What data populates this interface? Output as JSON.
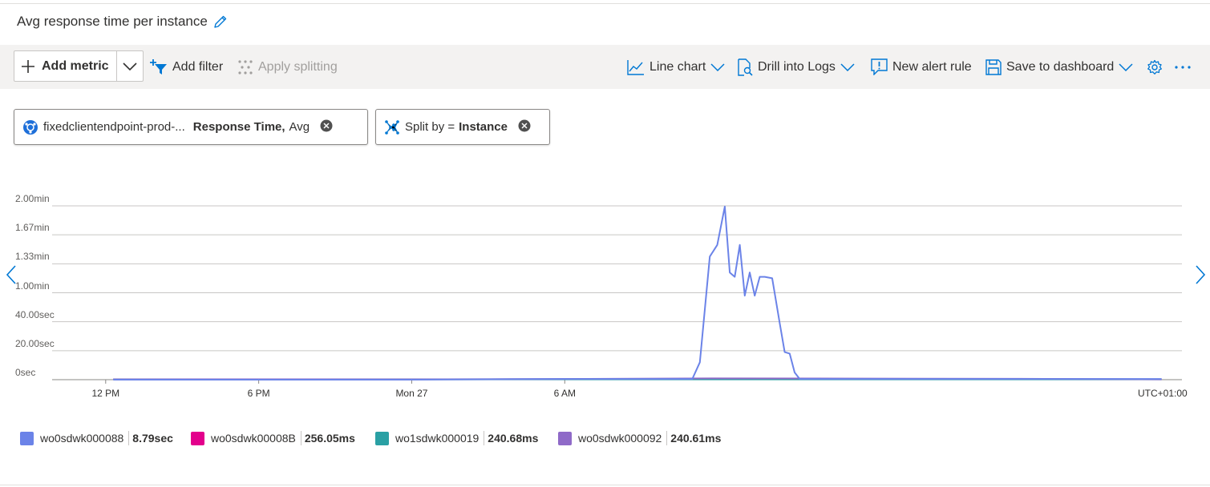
{
  "title": "Avg response time per instance",
  "toolbar": {
    "add_metric": "Add metric",
    "add_filter": "Add filter",
    "apply_splitting": "Apply splitting",
    "line_chart": "Line chart",
    "drill_into_logs": "Drill into Logs",
    "new_alert_rule": "New alert rule",
    "save_to_dashboard": "Save to dashboard"
  },
  "pills": {
    "metric_resource": "fixedclientendpoint-prod-...",
    "metric_name": "Response Time,",
    "metric_agg": "Avg",
    "split_prefix": "Split by =",
    "split_value": "Instance"
  },
  "chart_data": {
    "type": "line",
    "yticks": [
      "0sec",
      "20.00sec",
      "40.00sec",
      "1.00min",
      "1.33min",
      "1.67min",
      "2.00min"
    ],
    "xticks": [
      "12 PM",
      "6 PM",
      "Mon 27",
      "6 AM"
    ],
    "timezone": "UTC+01:00",
    "ylim_seconds": [
      0,
      120
    ],
    "series": [
      {
        "name": "wo0sdwk000088",
        "color": "#6b83e8",
        "summary": "8.79sec",
        "t_hours": [
          0,
          6,
          12,
          18,
          23.2,
          23.5,
          23.9,
          24.2,
          24.5,
          24.7,
          24.9,
          25.1,
          25.3,
          25.5,
          25.7,
          25.9,
          26.1,
          26.4,
          26.7,
          26.9,
          27.1,
          27.3,
          27.5,
          28.0,
          32,
          38,
          42
        ],
        "values_seconds": [
          0,
          0,
          0,
          0.5,
          0.5,
          12,
          85,
          93,
          119.5,
          74,
          71,
          93,
          58,
          74,
          58,
          71,
          71,
          70,
          39,
          19,
          18,
          5,
          0.5,
          0.5,
          0.5,
          0.5,
          0.5
        ]
      },
      {
        "name": "wo0sdwk00008B",
        "color": "#e3008c",
        "summary": "256.05ms",
        "t_hours": [
          0,
          42
        ],
        "values_seconds": [
          0.26,
          0.26
        ]
      },
      {
        "name": "wo1sdwk000019",
        "color": "#2aa0a4",
        "summary": "240.68ms",
        "t_hours": [
          0,
          42
        ],
        "values_seconds": [
          0.24,
          0.24
        ]
      },
      {
        "name": "wo0sdwk000092",
        "color": "#8f6ac8",
        "summary": "240.61ms",
        "t_hours": [
          0,
          6,
          12,
          18,
          24,
          30,
          36,
          42
        ],
        "values_seconds": [
          0.24,
          0.3,
          0.24,
          0.5,
          0.9,
          0.8,
          0.6,
          0.24
        ]
      }
    ]
  }
}
